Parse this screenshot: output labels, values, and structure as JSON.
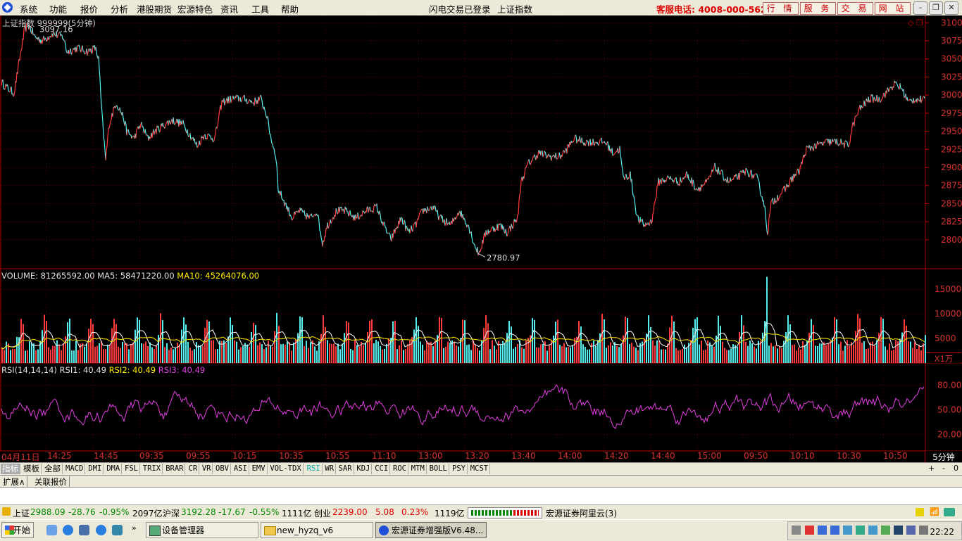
{
  "menu": {
    "items": [
      "系统",
      "功能",
      "报价",
      "分析",
      "港股期货",
      "宏源特色",
      "资讯",
      "工具",
      "帮助"
    ],
    "status1": "闪电交易已登录",
    "status2": "上证指数",
    "hotline": "客服电话: 4008-000-562",
    "buttons": [
      "行 情",
      "服 务",
      "交 易",
      "网 站"
    ]
  },
  "main_label": "上证指数 999999(5分钟)",
  "high_label": "3097.16",
  "low_label": "2780.97",
  "volume_header": {
    "name": "VOLUME: 81265592.00",
    "ma5": "MA5: 58471220.00",
    "ma10": "MA10: 45264076.00"
  },
  "volume_unit": "X1万",
  "rsi_header": {
    "name": "RSI(14,14,14)",
    "rsi1": "RSI1: 40.49",
    "rsi2": "RSI2: 40.49",
    "rsi3": "RSI3: 40.49"
  },
  "x_ticks": [
    "04月11日",
    "14:25",
    "14:45",
    "09:35",
    "09:55",
    "10:15",
    "10:35",
    "10:55",
    "11:10",
    "13:00",
    "13:20",
    "13:40",
    "14:00",
    "14:20",
    "14:40",
    "15:00",
    "09:50",
    "10:10",
    "10:30",
    "10:50"
  ],
  "x_period": "5分钟",
  "indicator_tabs": [
    "指标",
    "模板",
    "全部",
    "MACD",
    "DMI",
    "DMA",
    "FSL",
    "TRIX",
    "BRAR",
    "CR",
    "VR",
    "OBV",
    "ASI",
    "EMV",
    "VOL-TDX",
    "RSI",
    "WR",
    "SAR",
    "KDJ",
    "CCI",
    "ROC",
    "MTM",
    "BOLL",
    "PSY",
    "MCST"
  ],
  "indicator_ctrl": [
    "+",
    "-",
    "0"
  ],
  "ext_tabs": [
    "扩展∧",
    "关联报价"
  ],
  "status_bar": {
    "sh_name": "上证",
    "sh_value": "2988.09",
    "sh_change": "-28.76",
    "sh_pct": "-0.95%",
    "sh_amount": "2097亿",
    "hs_name": "沪深",
    "hs_value": "3192.28",
    "hs_change": "-17.67",
    "hs_pct": "-0.55%",
    "hs_amount": "1111亿",
    "cy_name": "创业",
    "cy_value": "2239.00",
    "cy_change": "5.08",
    "cy_pct": "0.23%",
    "cy_amount": "1119亿",
    "server": "宏源证券阿里云(3)"
  },
  "taskbar": {
    "start": "开始",
    "tasks": [
      "设备管理器",
      "new_hyzq_v6",
      "宏源证券增强版V6.48..."
    ],
    "clock": "22:22"
  },
  "chart_data": [
    {
      "type": "line",
      "name": "price",
      "ylim": [
        2760,
        3110
      ],
      "y_ticks": [
        3100,
        3075,
        3050,
        3025,
        3000,
        2975,
        2950,
        2925,
        2900,
        2875,
        2850,
        2825,
        2800
      ],
      "points": [
        [
          0,
          3020
        ],
        [
          10,
          3010
        ],
        [
          20,
          3003
        ],
        [
          28,
          3050
        ],
        [
          35,
          3090
        ],
        [
          40,
          3097
        ],
        [
          50,
          3080
        ],
        [
          60,
          3075
        ],
        [
          75,
          3085
        ],
        [
          90,
          3080
        ],
        [
          95,
          3060
        ],
        [
          110,
          3065
        ],
        [
          125,
          3060
        ],
        [
          135,
          3065
        ],
        [
          140,
          3050
        ],
        [
          145,
          2970
        ],
        [
          150,
          2910
        ],
        [
          155,
          2960
        ],
        [
          165,
          2990
        ],
        [
          175,
          2970
        ],
        [
          180,
          2950
        ],
        [
          190,
          2940
        ],
        [
          200,
          2960
        ],
        [
          210,
          2940
        ],
        [
          220,
          2950
        ],
        [
          235,
          2960
        ],
        [
          245,
          2965
        ],
        [
          260,
          2960
        ],
        [
          270,
          2945
        ],
        [
          280,
          2930
        ],
        [
          290,
          2945
        ],
        [
          305,
          2940
        ],
        [
          315,
          2990
        ],
        [
          330,
          2995
        ],
        [
          345,
          2995
        ],
        [
          360,
          2990
        ],
        [
          370,
          2995
        ],
        [
          378,
          2975
        ],
        [
          385,
          2940
        ],
        [
          392,
          2915
        ],
        [
          395,
          2870
        ],
        [
          405,
          2850
        ],
        [
          415,
          2830
        ],
        [
          425,
          2840
        ],
        [
          440,
          2830
        ],
        [
          450,
          2840
        ],
        [
          458,
          2795
        ],
        [
          465,
          2820
        ],
        [
          478,
          2840
        ],
        [
          490,
          2840
        ],
        [
          505,
          2830
        ],
        [
          520,
          2840
        ],
        [
          535,
          2845
        ],
        [
          545,
          2820
        ],
        [
          555,
          2800
        ],
        [
          570,
          2830
        ],
        [
          580,
          2810
        ],
        [
          590,
          2820
        ],
        [
          600,
          2840
        ],
        [
          615,
          2845
        ],
        [
          625,
          2830
        ],
        [
          640,
          2820
        ],
        [
          652,
          2840
        ],
        [
          665,
          2820
        ],
        [
          675,
          2790
        ],
        [
          680,
          2781
        ],
        [
          690,
          2810
        ],
        [
          700,
          2815
        ],
        [
          710,
          2820
        ],
        [
          720,
          2810
        ],
        [
          735,
          2830
        ],
        [
          740,
          2880
        ],
        [
          750,
          2905
        ],
        [
          765,
          2920
        ],
        [
          780,
          2915
        ],
        [
          795,
          2915
        ],
        [
          805,
          2925
        ],
        [
          815,
          2940
        ],
        [
          830,
          2935
        ],
        [
          845,
          2935
        ],
        [
          860,
          2935
        ],
        [
          870,
          2920
        ],
        [
          880,
          2925
        ],
        [
          885,
          2885
        ],
        [
          895,
          2890
        ],
        [
          905,
          2830
        ],
        [
          915,
          2820
        ],
        [
          925,
          2825
        ],
        [
          935,
          2880
        ],
        [
          950,
          2885
        ],
        [
          965,
          2880
        ],
        [
          975,
          2890
        ],
        [
          990,
          2870
        ],
        [
          1005,
          2880
        ],
        [
          1015,
          2900
        ],
        [
          1025,
          2890
        ],
        [
          1035,
          2880
        ],
        [
          1045,
          2885
        ],
        [
          1060,
          2895
        ],
        [
          1075,
          2885
        ],
        [
          1085,
          2850
        ],
        [
          1090,
          2810
        ],
        [
          1095,
          2850
        ],
        [
          1105,
          2860
        ],
        [
          1115,
          2870
        ],
        [
          1125,
          2885
        ],
        [
          1135,
          2895
        ],
        [
          1145,
          2925
        ],
        [
          1160,
          2930
        ],
        [
          1175,
          2935
        ],
        [
          1190,
          2935
        ],
        [
          1205,
          2930
        ],
        [
          1210,
          2955
        ],
        [
          1220,
          2980
        ],
        [
          1235,
          2995
        ],
        [
          1250,
          2995
        ],
        [
          1260,
          3005
        ],
        [
          1270,
          3015
        ],
        [
          1280,
          3010
        ],
        [
          1290,
          2990
        ],
        [
          1300,
          2995
        ],
        [
          1313,
          2992
        ]
      ]
    },
    {
      "type": "bar",
      "name": "volume",
      "unit": "X1万",
      "ylim": [
        0,
        18000
      ],
      "y_ticks": [
        15000,
        10000,
        5000
      ]
    },
    {
      "type": "line",
      "name": "rsi",
      "ylim": [
        0,
        100
      ],
      "y_ticks": [
        80,
        50,
        20
      ]
    }
  ]
}
